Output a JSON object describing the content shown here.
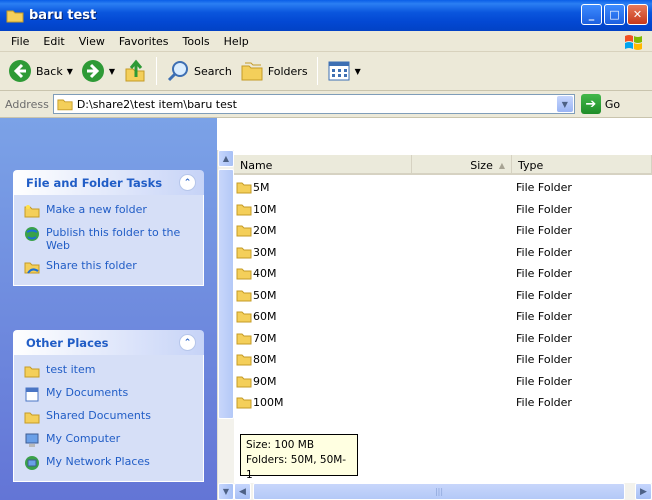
{
  "window": {
    "title": "baru test"
  },
  "menu": [
    "File",
    "Edit",
    "View",
    "Favorites",
    "Tools",
    "Help"
  ],
  "toolbar": {
    "back": "Back",
    "search": "Search",
    "folders": "Folders"
  },
  "address": {
    "label": "Address",
    "path": "D:\\share2\\test item\\baru test",
    "go": "Go"
  },
  "tasks": {
    "file_folder": {
      "title": "File and Folder Tasks",
      "items": [
        "Make a new folder",
        "Publish this folder to the Web",
        "Share this folder"
      ]
    },
    "other_places": {
      "title": "Other Places",
      "items": [
        "test item",
        "My Documents",
        "Shared Documents",
        "My Computer",
        "My Network Places"
      ]
    }
  },
  "columns": {
    "name": "Name",
    "size": "Size",
    "type": "Type"
  },
  "files": [
    {
      "name": "5M",
      "type": "File Folder"
    },
    {
      "name": "10M",
      "type": "File Folder"
    },
    {
      "name": "20M",
      "type": "File Folder"
    },
    {
      "name": "30M",
      "type": "File Folder"
    },
    {
      "name": "40M",
      "type": "File Folder"
    },
    {
      "name": "50M",
      "type": "File Folder"
    },
    {
      "name": "60M",
      "type": "File Folder"
    },
    {
      "name": "70M",
      "type": "File Folder"
    },
    {
      "name": "80M",
      "type": "File Folder"
    },
    {
      "name": "90M",
      "type": "File Folder"
    },
    {
      "name": "100M",
      "type": "File Folder"
    }
  ],
  "tooltip": {
    "line1": "Size: 100 MB",
    "line2": "Folders: 50M, 50M-1"
  },
  "colors": {
    "titlebar": "#0a56dd",
    "taskpane": "#6f8ede",
    "link": "#215dc6",
    "folder": "#f4cf5a"
  },
  "icons": [
    "folder-icon",
    "back-icon",
    "forward-icon",
    "up-icon",
    "search-icon",
    "folders-icon",
    "views-icon",
    "go-icon",
    "windows-flag-icon"
  ]
}
